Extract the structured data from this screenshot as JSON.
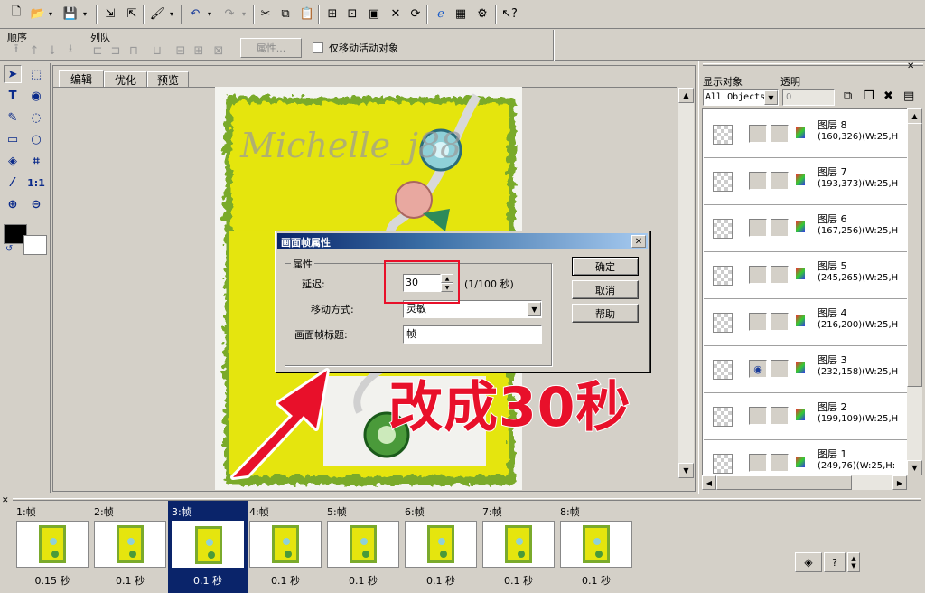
{
  "toolbar": {
    "order_label": "顺序",
    "queue_label": "列队",
    "props_button": "属性...",
    "move_active_label": "仅移动活动对象"
  },
  "tabs": [
    "编辑",
    "优化",
    "预览"
  ],
  "canvas": {
    "watermark": "Michelle_j88",
    "annotation": "改成30秒"
  },
  "dialog": {
    "title": "画面帧属性",
    "group_label": "属性",
    "delay_label": "延迟:",
    "delay_value": "30",
    "delay_unit": "(1/100 秒)",
    "move_label": "移动方式:",
    "move_value": "灵敏",
    "frame_title_label": "画面帧标题:",
    "frame_title_value": "帧",
    "ok": "确定",
    "cancel": "取消",
    "help": "帮助"
  },
  "layers_panel": {
    "show_label": "显示对象",
    "opacity_label": "透明",
    "filter_value": "All Objects",
    "opacity_value": "0",
    "layers": [
      {
        "name": "图层 8",
        "info": "(160,326)(W:25,H"
      },
      {
        "name": "图层 7",
        "info": "(193,373)(W:25,H"
      },
      {
        "name": "图层 6",
        "info": "(167,256)(W:25,H"
      },
      {
        "name": "图层 5",
        "info": "(245,265)(W:25,H"
      },
      {
        "name": "图层 4",
        "info": "(216,200)(W:25,H"
      },
      {
        "name": "图层 3",
        "info": "(232,158)(W:25,H"
      },
      {
        "name": "图层 2",
        "info": "(199,109)(W:25,H"
      },
      {
        "name": "图层 1",
        "info": "(249,76)(W:25,H:"
      }
    ]
  },
  "frames": [
    {
      "label": "1:帧",
      "time": "0.15 秒"
    },
    {
      "label": "2:帧",
      "time": "0.1 秒"
    },
    {
      "label": "3:帧",
      "time": "0.1 秒"
    },
    {
      "label": "4:帧",
      "time": "0.1 秒"
    },
    {
      "label": "5:帧",
      "time": "0.1 秒"
    },
    {
      "label": "6:帧",
      "time": "0.1 秒"
    },
    {
      "label": "7:帧",
      "time": "0.1 秒"
    },
    {
      "label": "8:帧",
      "time": "0.1 秒"
    }
  ],
  "selected_frame": 3,
  "colors": {
    "selection": "#0a246a",
    "canvas_yellow": "#e5e50e",
    "frame_green": "#7aaa2c",
    "annotation_red": "#e8102a"
  }
}
